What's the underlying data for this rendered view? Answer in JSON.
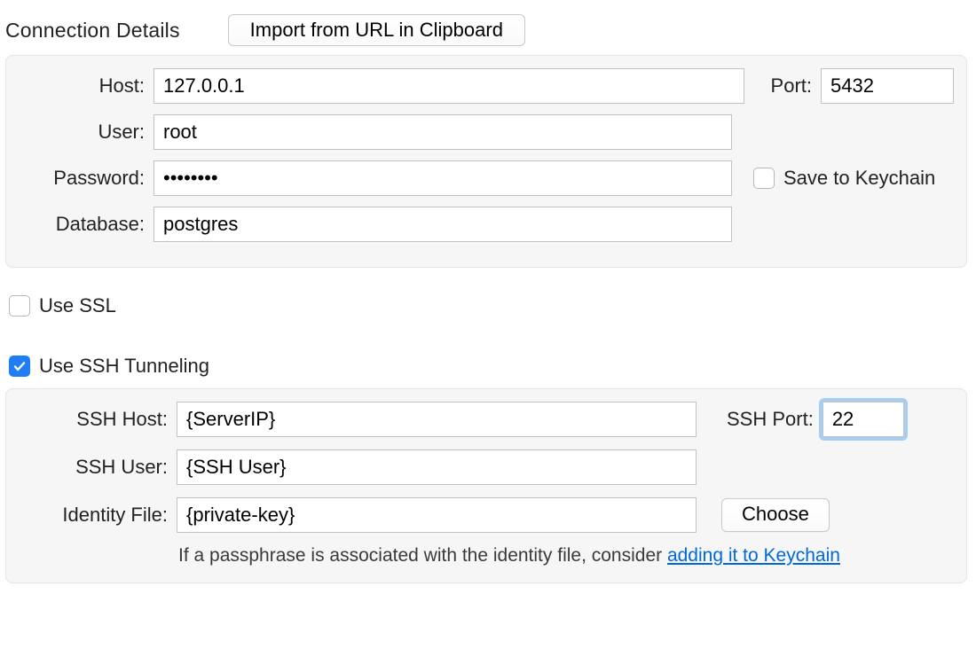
{
  "header": {
    "section_title": "Connection Details",
    "import_button": "Import from URL in Clipboard"
  },
  "connection": {
    "host_label": "Host:",
    "host_value": "127.0.0.1",
    "port_label": "Port:",
    "port_value": "5432",
    "user_label": "User:",
    "user_value": "root",
    "password_label": "Password:",
    "password_value": "••••••••",
    "save_keychain_label": "Save to Keychain",
    "save_keychain_checked": false,
    "database_label": "Database:",
    "database_value": "postgres"
  },
  "ssl": {
    "label": "Use SSL",
    "checked": false
  },
  "ssh": {
    "enable_label": "Use SSH Tunneling",
    "enabled": true,
    "host_label": "SSH Host:",
    "host_value": "{ServerIP}",
    "port_label": "SSH Port:",
    "port_value": "22",
    "user_label": "SSH User:",
    "user_value": "{SSH User}",
    "identity_label": "Identity File:",
    "identity_value": "{private-key}",
    "choose_button": "Choose",
    "hint_prefix": "If a passphrase is associated with the identity file, consider ",
    "hint_link": "adding it to Keychain"
  }
}
